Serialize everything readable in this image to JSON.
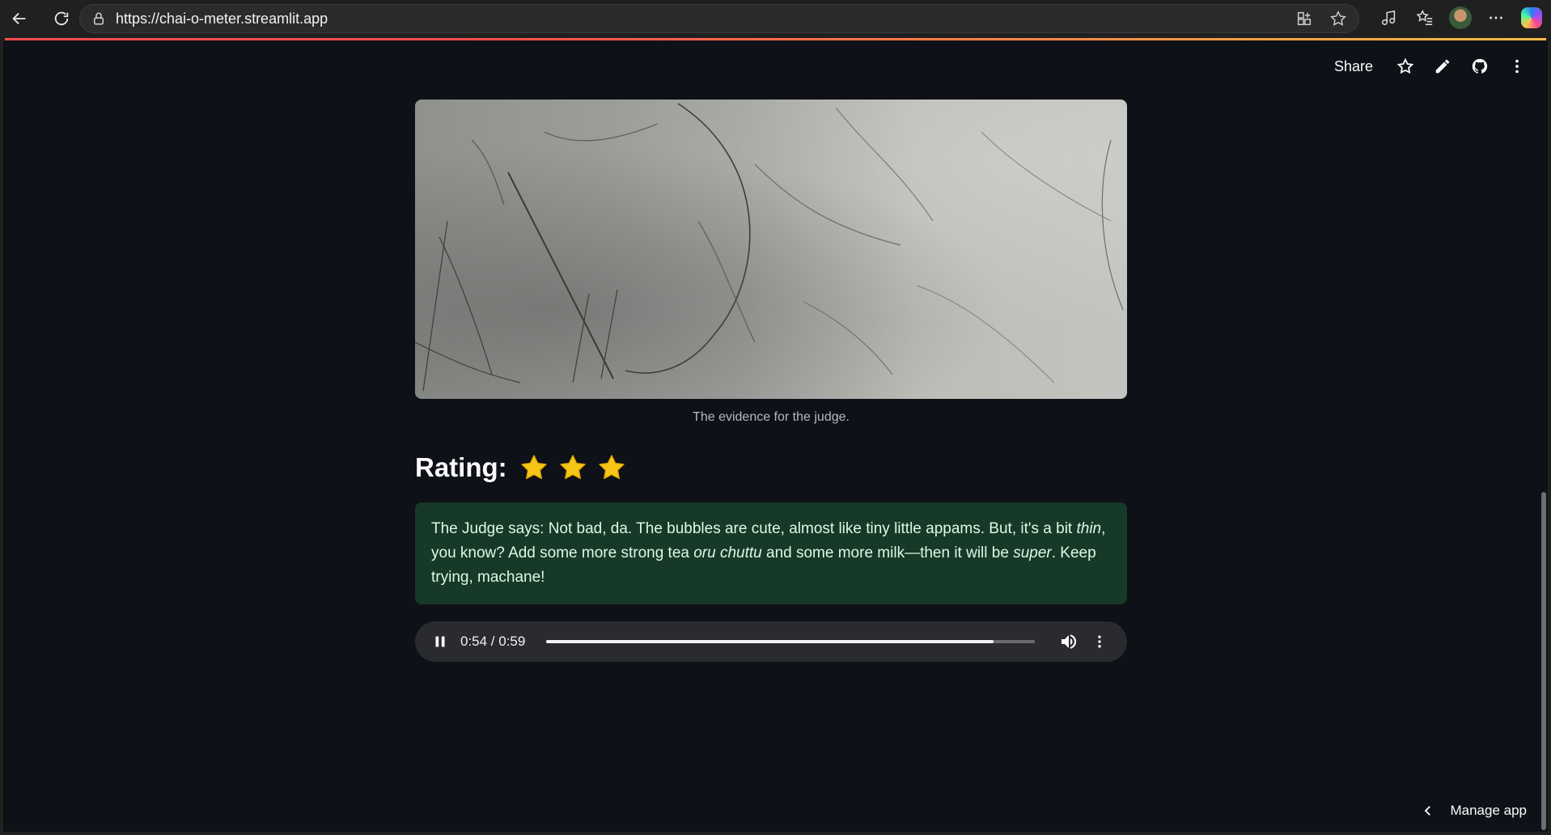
{
  "browser": {
    "url": "https://chai-o-meter.streamlit.app"
  },
  "toolbar": {
    "share_label": "Share"
  },
  "evidence": {
    "caption": "The evidence for the judge."
  },
  "rating": {
    "label": "Rating:",
    "stars": 3
  },
  "judge": {
    "text": "The Judge says: Not bad, da. The bubbles are cute, almost like tiny little appams. But, it's a bit thin, you know? Add some more strong tea oru chuttu and some more milk—then it will be super. Keep trying, machane!",
    "part1": "The Judge says: Not bad, da. The bubbles are cute, almost like tiny little appams. But, it's a bit ",
    "em1": "thin",
    "part2": ", you know? Add some more strong tea ",
    "em2": "oru chuttu",
    "part3": " and some more milk—then it will be ",
    "em3": "super",
    "part4": ". Keep trying, machane!"
  },
  "audio": {
    "time": "0:54 / 0:59",
    "current_seconds": 54,
    "duration_seconds": 59,
    "state": "playing"
  },
  "manage": {
    "label": "Manage app"
  },
  "colors": {
    "app_background": "#0e1117",
    "judge_box": "#173928",
    "star": "#f5c518",
    "accent_left": "#ff4b4b",
    "accent_right": "#ffbd45"
  }
}
